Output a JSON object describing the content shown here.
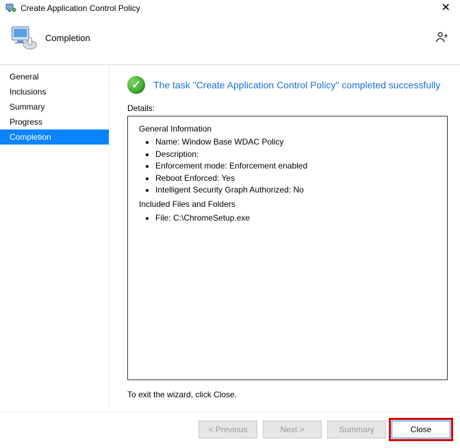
{
  "window": {
    "title": "Create Application Control Policy"
  },
  "header": {
    "title": "Completion"
  },
  "sidebar": {
    "items": [
      {
        "label": "General",
        "active": false
      },
      {
        "label": "Inclusions",
        "active": false
      },
      {
        "label": "Summary",
        "active": false
      },
      {
        "label": "Progress",
        "active": false
      },
      {
        "label": "Completion",
        "active": true
      }
    ]
  },
  "main": {
    "status_message": "The task \"Create Application Control Policy\" completed successfully",
    "details_label": "Details:",
    "details": {
      "general_info_heading": "General Information",
      "general_info": [
        "Name: Window Base WDAC Policy",
        "Description:",
        "Enforcement mode: Enforcement enabled",
        "Reboot Enforced: Yes",
        "Intelligent Security Graph Authorized: No"
      ],
      "included_heading": "Included Files and Folders",
      "included_items": [
        "File: C:\\ChromeSetup.exe"
      ]
    },
    "hint": "To exit the wizard, click Close."
  },
  "footer": {
    "previous": "< Previous",
    "next": "Next >",
    "summary": "Summary",
    "close": "Close"
  }
}
